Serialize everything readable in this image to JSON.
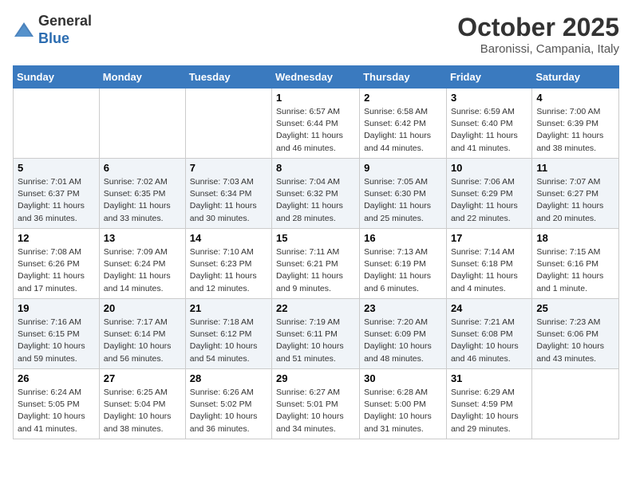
{
  "header": {
    "logo_line1": "General",
    "logo_line2": "Blue",
    "month_title": "October 2025",
    "location": "Baronissi, Campania, Italy"
  },
  "days_of_week": [
    "Sunday",
    "Monday",
    "Tuesday",
    "Wednesday",
    "Thursday",
    "Friday",
    "Saturday"
  ],
  "weeks": [
    [
      {
        "day": "",
        "info": ""
      },
      {
        "day": "",
        "info": ""
      },
      {
        "day": "",
        "info": ""
      },
      {
        "day": "1",
        "info": "Sunrise: 6:57 AM\nSunset: 6:44 PM\nDaylight: 11 hours and 46 minutes."
      },
      {
        "day": "2",
        "info": "Sunrise: 6:58 AM\nSunset: 6:42 PM\nDaylight: 11 hours and 44 minutes."
      },
      {
        "day": "3",
        "info": "Sunrise: 6:59 AM\nSunset: 6:40 PM\nDaylight: 11 hours and 41 minutes."
      },
      {
        "day": "4",
        "info": "Sunrise: 7:00 AM\nSunset: 6:39 PM\nDaylight: 11 hours and 38 minutes."
      }
    ],
    [
      {
        "day": "5",
        "info": "Sunrise: 7:01 AM\nSunset: 6:37 PM\nDaylight: 11 hours and 36 minutes."
      },
      {
        "day": "6",
        "info": "Sunrise: 7:02 AM\nSunset: 6:35 PM\nDaylight: 11 hours and 33 minutes."
      },
      {
        "day": "7",
        "info": "Sunrise: 7:03 AM\nSunset: 6:34 PM\nDaylight: 11 hours and 30 minutes."
      },
      {
        "day": "8",
        "info": "Sunrise: 7:04 AM\nSunset: 6:32 PM\nDaylight: 11 hours and 28 minutes."
      },
      {
        "day": "9",
        "info": "Sunrise: 7:05 AM\nSunset: 6:30 PM\nDaylight: 11 hours and 25 minutes."
      },
      {
        "day": "10",
        "info": "Sunrise: 7:06 AM\nSunset: 6:29 PM\nDaylight: 11 hours and 22 minutes."
      },
      {
        "day": "11",
        "info": "Sunrise: 7:07 AM\nSunset: 6:27 PM\nDaylight: 11 hours and 20 minutes."
      }
    ],
    [
      {
        "day": "12",
        "info": "Sunrise: 7:08 AM\nSunset: 6:26 PM\nDaylight: 11 hours and 17 minutes."
      },
      {
        "day": "13",
        "info": "Sunrise: 7:09 AM\nSunset: 6:24 PM\nDaylight: 11 hours and 14 minutes."
      },
      {
        "day": "14",
        "info": "Sunrise: 7:10 AM\nSunset: 6:23 PM\nDaylight: 11 hours and 12 minutes."
      },
      {
        "day": "15",
        "info": "Sunrise: 7:11 AM\nSunset: 6:21 PM\nDaylight: 11 hours and 9 minutes."
      },
      {
        "day": "16",
        "info": "Sunrise: 7:13 AM\nSunset: 6:19 PM\nDaylight: 11 hours and 6 minutes."
      },
      {
        "day": "17",
        "info": "Sunrise: 7:14 AM\nSunset: 6:18 PM\nDaylight: 11 hours and 4 minutes."
      },
      {
        "day": "18",
        "info": "Sunrise: 7:15 AM\nSunset: 6:16 PM\nDaylight: 11 hours and 1 minute."
      }
    ],
    [
      {
        "day": "19",
        "info": "Sunrise: 7:16 AM\nSunset: 6:15 PM\nDaylight: 10 hours and 59 minutes."
      },
      {
        "day": "20",
        "info": "Sunrise: 7:17 AM\nSunset: 6:14 PM\nDaylight: 10 hours and 56 minutes."
      },
      {
        "day": "21",
        "info": "Sunrise: 7:18 AM\nSunset: 6:12 PM\nDaylight: 10 hours and 54 minutes."
      },
      {
        "day": "22",
        "info": "Sunrise: 7:19 AM\nSunset: 6:11 PM\nDaylight: 10 hours and 51 minutes."
      },
      {
        "day": "23",
        "info": "Sunrise: 7:20 AM\nSunset: 6:09 PM\nDaylight: 10 hours and 48 minutes."
      },
      {
        "day": "24",
        "info": "Sunrise: 7:21 AM\nSunset: 6:08 PM\nDaylight: 10 hours and 46 minutes."
      },
      {
        "day": "25",
        "info": "Sunrise: 7:23 AM\nSunset: 6:06 PM\nDaylight: 10 hours and 43 minutes."
      }
    ],
    [
      {
        "day": "26",
        "info": "Sunrise: 6:24 AM\nSunset: 5:05 PM\nDaylight: 10 hours and 41 minutes."
      },
      {
        "day": "27",
        "info": "Sunrise: 6:25 AM\nSunset: 5:04 PM\nDaylight: 10 hours and 38 minutes."
      },
      {
        "day": "28",
        "info": "Sunrise: 6:26 AM\nSunset: 5:02 PM\nDaylight: 10 hours and 36 minutes."
      },
      {
        "day": "29",
        "info": "Sunrise: 6:27 AM\nSunset: 5:01 PM\nDaylight: 10 hours and 34 minutes."
      },
      {
        "day": "30",
        "info": "Sunrise: 6:28 AM\nSunset: 5:00 PM\nDaylight: 10 hours and 31 minutes."
      },
      {
        "day": "31",
        "info": "Sunrise: 6:29 AM\nSunset: 4:59 PM\nDaylight: 10 hours and 29 minutes."
      },
      {
        "day": "",
        "info": ""
      }
    ]
  ]
}
